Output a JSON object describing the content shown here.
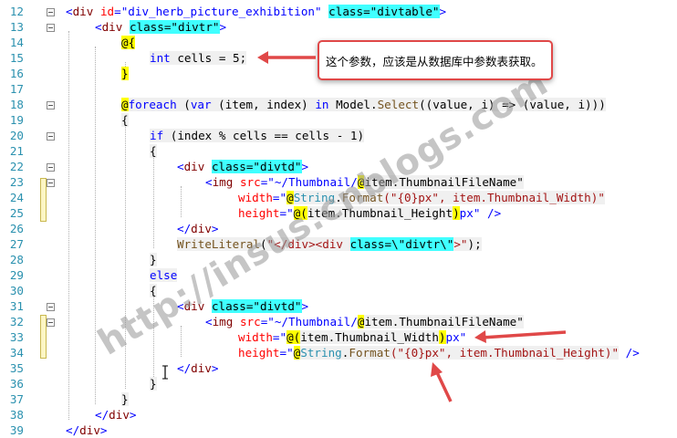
{
  "editor": {
    "line_numbers": [
      "12",
      "13",
      "14",
      "15",
      "16",
      "17",
      "18",
      "19",
      "20",
      "21",
      "22",
      "23",
      "24",
      "25",
      "26",
      "27",
      "28",
      "29",
      "30",
      "31",
      "32",
      "33",
      "34",
      "35",
      "36",
      "37",
      "38",
      "39"
    ],
    "lines": {
      "l12": {
        "a": "<",
        "b": "div",
        "c": " ",
        "d": "id",
        "e": "=\"div_herb_picture_exhibition\"",
        "f": " ",
        "g": "class=\"divtable\"",
        "h": ">"
      },
      "l13": {
        "a": "<",
        "b": "div",
        "c": " ",
        "g": "class=\"divtr\"",
        "h": ">"
      },
      "l14": {
        "a": "@{"
      },
      "l15": {
        "kw": "int",
        "rest": " cells = 5;"
      },
      "l16": {
        "a": "}"
      },
      "l18": {
        "at": "@",
        "kw": "foreach",
        "p1": " (",
        "kw2": "var",
        "p2": " (item, index) ",
        "kw3": "in",
        "p3": " Model.",
        "mt": "Select",
        "p4": "((value, i) => (value, i)))"
      },
      "l19": {
        "a": "{"
      },
      "l20": {
        "kw": "if",
        "rest": " (index % cells == cells - 1)"
      },
      "l21": {
        "a": "{"
      },
      "l22": {
        "a": "<",
        "b": "div",
        "c": " ",
        "g": "class=\"divtd\"",
        "h": ">"
      },
      "l23": {
        "a": "<",
        "b": "img",
        "c": " ",
        "d": "src",
        "e1": "=\"~/Thumbnail/",
        "at": "@",
        "e2": "item.ThumbnailFileName\""
      },
      "l24": {
        "d": "width",
        "e1": "=\"",
        "at": "@",
        "ty": "String",
        "dot": ".",
        "mt": "Format",
        "e2": "(\"{0}px\", item.Thumbnail_Width)\""
      },
      "l25": {
        "d": "height",
        "e1": "=\"",
        "at": "@(",
        "e2": "item.Thumbnail_Height",
        "at2": ")",
        "e3": "px\"",
        "h": " />"
      },
      "l26": {
        "a": "</",
        "b": "div",
        "h": ">"
      },
      "l27": {
        "mt": "WriteLiteral",
        "p1": "(",
        "s1": "\"</div><div ",
        "hl": "class=\\\"divtr\\\"",
        "s2": ">\"",
        "p2": ");"
      },
      "l28": {
        "a": "}"
      },
      "l29": {
        "kw": "else"
      },
      "l30": {
        "a": "{"
      },
      "l31": {
        "a": "<",
        "b": "div",
        "c": " ",
        "g": "class=\"divtd\"",
        "h": ">"
      },
      "l32": {
        "a": "<",
        "b": "img",
        "c": " ",
        "d": "src",
        "e1": "=\"~/Thumbnail/",
        "at": "@",
        "e2": "item.ThumbnailFileName\""
      },
      "l33": {
        "d": "width",
        "e1": "=\"",
        "at": "@(",
        "e2": "item.Thumbnail_Width",
        "at2": ")",
        "e3": "px\""
      },
      "l34": {
        "d": "height",
        "e1": "=\"",
        "at": "@",
        "ty": "String",
        "dot": ".",
        "mt": "Format",
        "e2": "(\"{0}px\", item.Thumbnail_Height)\"",
        "h": " />"
      },
      "l35": {
        "a": "</",
        "b": "div",
        "h": ">"
      },
      "l36": {
        "a": "}"
      },
      "l37": {
        "a": "}"
      },
      "l38": {
        "a": "</",
        "b": "div",
        "h": ">"
      },
      "l39": {
        "a": "</",
        "b": "div",
        "h": ">"
      }
    }
  },
  "callout": {
    "text": "这个参数，应该是从数据库中参数表获取。"
  },
  "watermark": {
    "text": "http://insus.cnblogs.com"
  },
  "colors": {
    "keyword": "#0000ff",
    "tag": "#800000",
    "attribute": "#ff0000",
    "line_number": "#2b91af",
    "highlight": "#40ffff",
    "razor": "#ffff00",
    "callout_border": "#e04848",
    "arrow": "#e04848"
  },
  "icons": [
    "fold-collapse-icon",
    "text-cursor-icon",
    "arrow-icon"
  ]
}
